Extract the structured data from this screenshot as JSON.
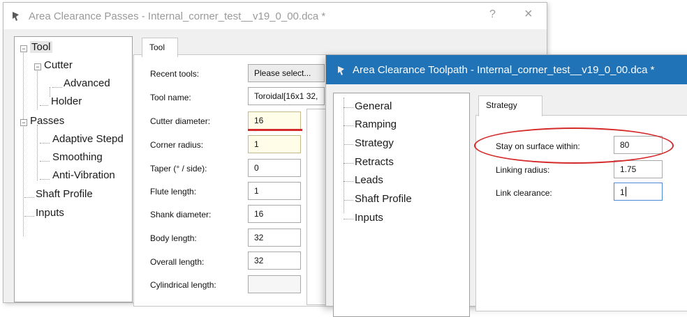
{
  "back_window": {
    "title": "Area Clearance Passes - Internal_corner_test__v19_0_00.dca *",
    "help_glyph": "?",
    "close_glyph": "×",
    "tree": [
      {
        "label": "Tool",
        "expander": "−"
      },
      {
        "label": "Cutter",
        "expander": "−"
      },
      {
        "label": "Advanced"
      },
      {
        "label": "Holder"
      },
      {
        "label": "Passes",
        "expander": "−"
      },
      {
        "label": "Adaptive Stepd"
      },
      {
        "label": "Smoothing"
      },
      {
        "label": "Anti-Vibration"
      },
      {
        "label": "Shaft Profile"
      },
      {
        "label": "Inputs"
      }
    ],
    "tab": "Tool",
    "fields": [
      {
        "label": "Recent tools:",
        "value": "Please select..."
      },
      {
        "label": "Tool name:",
        "value": "Toroidal[16x1 32,"
      },
      {
        "label": "Cutter diameter:",
        "value": "16"
      },
      {
        "label": "Corner radius:",
        "value": "1"
      },
      {
        "label": "Taper (° / side):",
        "value": "0"
      },
      {
        "label": "Flute length:",
        "value": "1"
      },
      {
        "label": "Shank diameter:",
        "value": "16"
      },
      {
        "label": "Body length:",
        "value": "32"
      },
      {
        "label": "Overall length:",
        "value": "32"
      },
      {
        "label": "Cylindrical length:",
        "value": ""
      }
    ]
  },
  "front_window": {
    "title": "Area Clearance Toolpath - Internal_corner_test__v19_0_00.dca *",
    "tree": [
      {
        "label": "General"
      },
      {
        "label": "Ramping"
      },
      {
        "label": "Strategy"
      },
      {
        "label": "Retracts"
      },
      {
        "label": "Leads"
      },
      {
        "label": "Shaft Profile"
      },
      {
        "label": "Inputs"
      }
    ],
    "tab": "Strategy",
    "fields": [
      {
        "label": "Stay on surface within:",
        "value": "80"
      },
      {
        "label": "Linking radius:",
        "value": "1.75"
      },
      {
        "label": "Link clearance:",
        "value": "1"
      }
    ]
  },
  "colors": {
    "titlebar_active": "#1f73b6",
    "annotation_red": "#d42a2a",
    "highlight_field": "#fffde8"
  }
}
